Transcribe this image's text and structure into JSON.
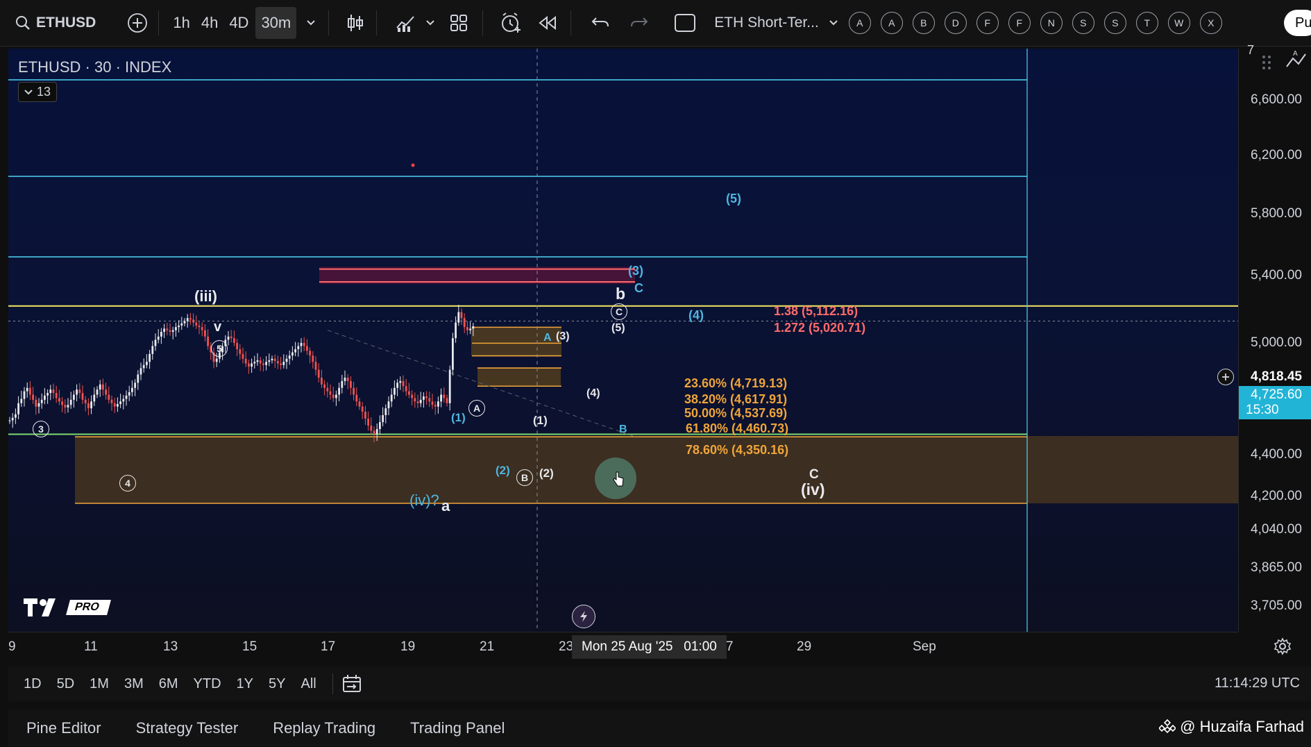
{
  "toolbar": {
    "symbol": "ETHUSD",
    "intervals": [
      "1h",
      "4h",
      "4D",
      "30m"
    ],
    "active_interval": "30m",
    "layout_name": "ETH Short-Ter...",
    "drawing_letters": [
      "A",
      "A",
      "B",
      "D",
      "F",
      "F",
      "N",
      "S",
      "S",
      "T",
      "W",
      "X"
    ],
    "publish_label": "Pu"
  },
  "chart": {
    "legend_title": "ETHUSD · 30 · INDEX",
    "indicators_count": "13",
    "wave_labels": {
      "iii": "(iii)",
      "v": "v",
      "circle5": "5",
      "circle3": "3",
      "circle4": "4",
      "iv_a": "(iv)?",
      "a": "a",
      "b": "b",
      "c_upper": "C",
      "c_lower": "C",
      "iv": "(iv)",
      "A_small": "A",
      "w3": "(3)",
      "circle_A": "A",
      "w1_blue": "(1)",
      "w2_blue": "(2)",
      "circle_B": "B",
      "w2_white": "(2)",
      "w1_white": "(1)",
      "w3_blue": "(3)",
      "w5_blue": "(5)",
      "w4_blue": "(4)",
      "circle_C": "C",
      "w5_white": "(5)",
      "w4_white": "(4)",
      "B_blue": "B"
    },
    "fib_levels": [
      {
        "label": "23.60% (4,719.13)"
      },
      {
        "label": "38.20% (4,617.91)"
      },
      {
        "label": "50.00% (4,537.69)"
      },
      {
        "label": "61.80% (4,460.73)"
      },
      {
        "label": "78.60% (4,350.16)"
      }
    ],
    "ext_levels": [
      {
        "label": "1.38 (5,112.16)"
      },
      {
        "label": "1.272 (5,020.71)"
      }
    ],
    "watermark": "PRO",
    "colors": {
      "bull": "#e8eaed",
      "bear": "#ef5350",
      "fib": "#f0a53a",
      "ext": "#ff6b6b",
      "cyan_line": "#4fd4f5",
      "yellow_line": "#f5e663",
      "green_line": "#7ddc6f",
      "current_price_bg": "#22b4d6"
    }
  },
  "price_axis": {
    "labels": [
      "6,600.00",
      "6,200.00",
      "5,800.00",
      "5,400.00",
      "5,000.00",
      "4,400.00",
      "4,200.00",
      "4,040.00",
      "3,865.00",
      "3,705.00"
    ],
    "top_label": "7",
    "highlight_price": "4,818.45",
    "current_price": "4,725.60",
    "countdown": "15:30"
  },
  "time_axis": {
    "labels": [
      "9",
      "11",
      "13",
      "15",
      "17",
      "19",
      "21",
      "23",
      "7",
      "29",
      "Sep"
    ],
    "crosshair_label": "Mon 25 Aug '25   01:00"
  },
  "range_bar": {
    "ranges": [
      "1D",
      "5D",
      "1M",
      "3M",
      "6M",
      "YTD",
      "1Y",
      "5Y",
      "All"
    ],
    "clock": "11:14:29 UTC"
  },
  "bottom_tabs": [
    "Pine Editor",
    "Strategy Tester",
    "Replay Trading",
    "Trading Panel"
  ],
  "author": "@ Huzaifa Farhad",
  "ohlc_series": [
    [
      0,
      4150
    ],
    [
      1,
      4165
    ],
    [
      2,
      4185
    ],
    [
      3,
      4250
    ],
    [
      4,
      4275
    ],
    [
      5,
      4320
    ],
    [
      6,
      4340
    ],
    [
      7,
      4300
    ],
    [
      8,
      4270
    ],
    [
      9,
      4230
    ],
    [
      10,
      4250
    ],
    [
      11,
      4270
    ],
    [
      12,
      4295
    ],
    [
      13,
      4310
    ],
    [
      14,
      4330
    ],
    [
      15,
      4310
    ],
    [
      16,
      4280
    ],
    [
      17,
      4260
    ],
    [
      18,
      4240
    ],
    [
      19,
      4225
    ],
    [
      20,
      4240
    ],
    [
      21,
      4270
    ],
    [
      22,
      4300
    ],
    [
      23,
      4330
    ],
    [
      24,
      4310
    ],
    [
      25,
      4270
    ],
    [
      26,
      4250
    ],
    [
      27,
      4220
    ],
    [
      28,
      4260
    ],
    [
      29,
      4300
    ],
    [
      30,
      4330
    ],
    [
      31,
      4360
    ],
    [
      32,
      4330
    ],
    [
      33,
      4300
    ],
    [
      34,
      4270
    ],
    [
      35,
      4250
    ],
    [
      36,
      4230
    ],
    [
      37,
      4245
    ],
    [
      38,
      4260
    ],
    [
      39,
      4275
    ],
    [
      40,
      4295
    ],
    [
      41,
      4315
    ],
    [
      42,
      4340
    ],
    [
      43,
      4370
    ],
    [
      44,
      4420
    ],
    [
      45,
      4460
    ],
    [
      46,
      4480
    ],
    [
      47,
      4500
    ],
    [
      48,
      4550
    ],
    [
      49,
      4600
    ],
    [
      50,
      4640
    ],
    [
      51,
      4660
    ],
    [
      52,
      4690
    ],
    [
      53,
      4710
    ],
    [
      54,
      4700
    ],
    [
      55,
      4690
    ],
    [
      56,
      4700
    ],
    [
      57,
      4720
    ],
    [
      58,
      4730
    ],
    [
      59,
      4745
    ],
    [
      60,
      4760
    ],
    [
      61,
      4780
    ],
    [
      62,
      4770
    ],
    [
      63,
      4750
    ],
    [
      64,
      4730
    ],
    [
      65,
      4720
    ],
    [
      66,
      4700
    ],
    [
      67,
      4660
    ],
    [
      68,
      4600
    ],
    [
      69,
      4560
    ],
    [
      70,
      4500
    ],
    [
      71,
      4520
    ],
    [
      72,
      4560
    ],
    [
      73,
      4600
    ],
    [
      74,
      4640
    ],
    [
      75,
      4660
    ],
    [
      76,
      4650
    ],
    [
      77,
      4620
    ],
    [
      78,
      4580
    ],
    [
      79,
      4550
    ],
    [
      80,
      4520
    ],
    [
      81,
      4490
    ],
    [
      82,
      4470
    ],
    [
      83,
      4490
    ],
    [
      84,
      4500
    ],
    [
      85,
      4510
    ],
    [
      86,
      4490
    ],
    [
      87,
      4480
    ],
    [
      88,
      4500
    ],
    [
      89,
      4510
    ],
    [
      90,
      4520
    ],
    [
      91,
      4505
    ],
    [
      92,
      4490
    ],
    [
      93,
      4480
    ],
    [
      94,
      4500
    ],
    [
      95,
      4520
    ],
    [
      96,
      4540
    ],
    [
      97,
      4560
    ],
    [
      98,
      4580
    ],
    [
      99,
      4600
    ],
    [
      100,
      4620
    ],
    [
      101,
      4600
    ],
    [
      102,
      4570
    ],
    [
      103,
      4540
    ],
    [
      104,
      4500
    ],
    [
      105,
      4450
    ],
    [
      106,
      4400
    ],
    [
      107,
      4360
    ],
    [
      108,
      4340
    ],
    [
      109,
      4320
    ],
    [
      110,
      4300
    ],
    [
      111,
      4280
    ],
    [
      112,
      4300
    ],
    [
      113,
      4340
    ],
    [
      114,
      4380
    ],
    [
      115,
      4400
    ],
    [
      116,
      4380
    ],
    [
      117,
      4340
    ],
    [
      118,
      4300
    ],
    [
      119,
      4260
    ],
    [
      120,
      4230
    ],
    [
      121,
      4200
    ],
    [
      122,
      4160
    ],
    [
      123,
      4120
    ],
    [
      124,
      4090
    ],
    [
      125,
      4070
    ],
    [
      126,
      4100
    ],
    [
      127,
      4140
    ],
    [
      128,
      4180
    ],
    [
      129,
      4220
    ],
    [
      130,
      4260
    ],
    [
      131,
      4300
    ],
    [
      132,
      4340
    ],
    [
      133,
      4370
    ],
    [
      134,
      4380
    ],
    [
      135,
      4350
    ],
    [
      136,
      4320
    ],
    [
      137,
      4300
    ],
    [
      138,
      4280
    ],
    [
      139,
      4260
    ],
    [
      140,
      4250
    ],
    [
      141,
      4270
    ],
    [
      142,
      4290
    ],
    [
      143,
      4280
    ],
    [
      144,
      4260
    ],
    [
      145,
      4240
    ],
    [
      146,
      4230
    ],
    [
      147,
      4260
    ],
    [
      148,
      4300
    ],
    [
      149,
      4280
    ],
    [
      150,
      4250
    ],
    [
      151,
      4450
    ],
    [
      152,
      4650
    ],
    [
      153,
      4750
    ],
    [
      154,
      4820
    ],
    [
      155,
      4780
    ],
    [
      156,
      4720
    ],
    [
      157,
      4700
    ],
    [
      158,
      4710
    ],
    [
      159,
      4725
    ]
  ]
}
